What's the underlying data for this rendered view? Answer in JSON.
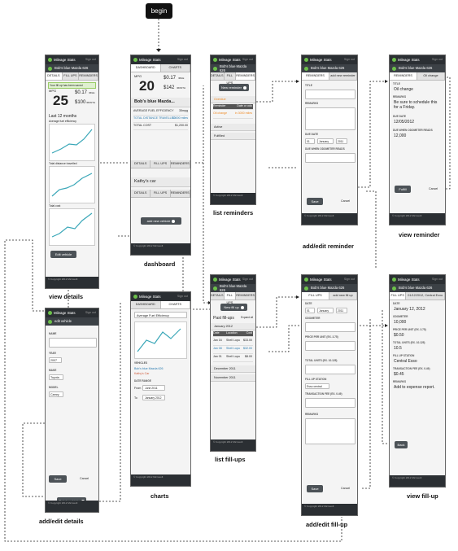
{
  "app": {
    "name": "Mileage Stats",
    "sign_out": "Sign out",
    "copyright": "© Copyright 2012 Microsoft"
  },
  "start": {
    "label": "begin"
  },
  "screens": {
    "view_details": {
      "caption": "view details",
      "vehicle": "Bob's blue Mazda 626",
      "tabs": [
        "DETAILS",
        "FILL UPS",
        "REMINDERS"
      ],
      "notice": "Your fill up has been saved",
      "mpg_label": "MPG",
      "mpg": "25",
      "cost_per_mile": "$0.17",
      "cost_per_month": "$100",
      "mile_unit": "/MILE",
      "month_unit": "/MONTH",
      "period": "Last 12 months",
      "charts": [
        "Average fuel efficiency",
        "Total distance travelled",
        "Total cost"
      ],
      "edit_button": "Edit vehicle"
    },
    "dashboard": {
      "caption": "dashboard",
      "tabs": [
        "DASHBOARD",
        "CHARTS"
      ],
      "mpg_label": "MPG",
      "mpg": "20",
      "cost_per_mile": "$0.17",
      "cost_per_month": "$142",
      "mile_unit": "/MILE",
      "month_unit": "/MONTH",
      "vehicle1": "Bob's blue Mazda...",
      "stats": [
        {
          "label": "AVERAGE FUEL EFFICIENCY",
          "value": "35mpg"
        },
        {
          "label": "TOTAL DISTANCE TRAVELLED",
          "value": "13000 miles"
        },
        {
          "label": "TOTAL COST",
          "value": "$1,200.00"
        }
      ],
      "vehicle_tabs": [
        "DETAILS",
        "FILL UPS",
        "REMINDERS"
      ],
      "vehicle2": "Kathy's car",
      "add_button": "add new vehicle"
    },
    "charts": {
      "caption": "charts",
      "tabs": [
        "DASHBOARD",
        "CHARTS"
      ],
      "select": "Average Fuel Efficiency",
      "vehicles_title": "VEHICLES",
      "vehicles": [
        "Bob's blue Mazda 626",
        "Kathy's Car"
      ],
      "date_range_title": "DATE RANGE",
      "from_label": "From",
      "from_value": "June 2011",
      "to_label": "To",
      "to_value": "January 2012"
    },
    "edit_details": {
      "caption": "add/edit details",
      "title": "edit vehicle",
      "name_label": "NAME",
      "year_label": "YEAR",
      "year": "2007",
      "make_label": "MAKE",
      "make": "Toyota",
      "model_label": "MODEL",
      "model": "Camry",
      "save": "Save",
      "cancel": "Cancel",
      "delete": "Delete vehicle"
    },
    "list_reminders": {
      "caption": "list reminders",
      "vehicle": "Bob's blue Mazda 626",
      "tabs": [
        "DETAILS",
        "FILL UPS",
        "REMINDERS"
      ],
      "new_button": "New reminder",
      "overdue": "Overdue",
      "col_a": "Reminder",
      "col_b": "Date or odo",
      "item": "Oil change",
      "item_due": "in 3000 miles",
      "active": "Active",
      "fulfilled": "Fulfilled"
    },
    "edit_reminder": {
      "caption": "add/edit reminder",
      "vehicle": "Bob's blue Mazda 626",
      "tab": "REMINDERS",
      "subtitle": "add new reminder",
      "title_label": "TITLE",
      "remarks_label": "REMARKS",
      "due_date_label": "DUE DATE",
      "day": "01",
      "month": "January",
      "year": "2011",
      "odometer_label": "DUE WHEN ODOMETER READS",
      "save": "Save",
      "cancel": "Cancel"
    },
    "view_reminder": {
      "caption": "view reminder",
      "vehicle": "Bob's blue Mazda 626",
      "tab": "REMINDERS",
      "subtitle": "Oil change",
      "title_label": "TITLE",
      "title": "Oil change",
      "remarks_label": "REMARKS",
      "remarks": "Be sure to schedule this for a Friday.",
      "due_date_label": "DUE DATE",
      "due_date": "12/05/2012",
      "odometer_label": "DUE WHEN ODOMETER READS",
      "odometer": "12,000",
      "fulfill": "Fulfill",
      "cancel": "Cancel"
    },
    "list_fillups": {
      "caption": "list fill-ups",
      "vehicle": "Bob's blue Mazda 626",
      "tabs": [
        "DETAILS",
        "FILL UPS",
        "REMINDERS"
      ],
      "new_button": "New fill up",
      "past": "Past fill-ups",
      "expand": "Expand all",
      "month1": "January 2012",
      "cols": [
        "Date",
        "Location",
        "Cost"
      ],
      "rows": [
        {
          "date": "Jan 16",
          "loc": "Shell Lupu",
          "cost": "$33.00"
        },
        {
          "date": "Jan 08",
          "loc": "Shell Lupu",
          "cost": "$32.00"
        },
        {
          "date": "Jan 01",
          "loc": "Shell Lupu",
          "cost": "$8.00"
        }
      ],
      "month2": "December 2011",
      "month3": "November 2011"
    },
    "edit_fillup": {
      "caption": "add/edit fill-up",
      "vehicle": "Bob's blue Mazda 626",
      "tab": "FILL UPS",
      "subtitle": "add new fill up",
      "date_label": "DATE",
      "day": "01",
      "month": "January",
      "year": "2011",
      "odometer_label": "ODOMETER",
      "ppu_label": "PRICE PER UNIT (EX. 3.75)",
      "units_label": "TOTAL UNITS (EX. 10.125)",
      "station_label": "FILL UP STATION",
      "station": "Esso central",
      "fee_label": "TRANSACTION FEE (EX. 0.49)",
      "remarks_label": "REMARKS",
      "save": "Save",
      "cancel": "Cancel"
    },
    "view_fillup": {
      "caption": "view fill-up",
      "vehicle": "Bob's blue Mazda 626",
      "tab": "FILL UPS",
      "subtitle": "01/12/2012, Central Exxo",
      "date_label": "DATE",
      "date": "January 12, 2012",
      "odometer_label": "ODOMETER",
      "odometer": "10,000",
      "ppu_label": "PRICE PER UNIT (EX. 3.75)",
      "ppu": "$0.50",
      "units_label": "TOTAL UNITS (EX. 10.125)",
      "units": "10.5",
      "station_label": "FILL UP STATION",
      "station": "Central Esso",
      "fee_label": "TRANSACTION FEE (EX. 0.49)",
      "fee": "$0.45",
      "remarks_label": "REMARKS",
      "remarks": "Add to expense report.",
      "back": "Back"
    }
  },
  "colors": {
    "header": "#2b2f33",
    "accent": "#6cc04a",
    "chart_line": "#3aa7b8",
    "overdue": "#f08a24",
    "button": "#4c5257"
  }
}
